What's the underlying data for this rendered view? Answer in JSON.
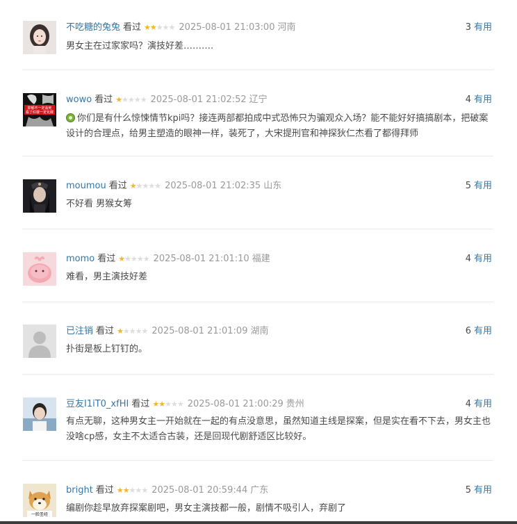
{
  "comments": [
    {
      "user": "不吃糖的兔兔",
      "status": "看过",
      "rating": 2,
      "time": "2025-08-01 21:03:00",
      "location": "河南",
      "votes": "3",
      "vote_label": "有用",
      "text": "男女主在过家家吗？演技好差……….",
      "avatar": "woman-portrait",
      "has_icon": false
    },
    {
      "user": "wowo",
      "status": "看过",
      "rating": 1,
      "time": "2025-08-01 21:02:52",
      "location": "辽宁",
      "votes": "4",
      "vote_label": "有用",
      "text": "你们是有什么惊悚情节kpi吗？接连两部都拍成中式恐怖只为骗观众入场？能不能好好搞搞剧本，把破案设计的合理点，给男主塑造的眼神一样，装死了，大宋提刑官和神探狄仁杰看了都得拜师",
      "avatar": "red-banner",
      "has_icon": true,
      "avatar_text": [
        "抑郁不一定会死",
        "看了红楼一定化蝶"
      ]
    },
    {
      "user": "moumou",
      "status": "看过",
      "rating": 1,
      "time": "2025-08-01 21:02:35",
      "location": "山东",
      "votes": "5",
      "vote_label": "有用",
      "text": "不好看 男猴女筹",
      "avatar": "costume-portrait",
      "has_icon": false
    },
    {
      "user": "momo",
      "status": "看过",
      "rating": 1,
      "time": "2025-08-01 21:01:10",
      "location": "福建",
      "votes": "4",
      "vote_label": "有用",
      "text": "难看，男主演技好差",
      "avatar": "pink-creature",
      "has_icon": false
    },
    {
      "user": "已注销",
      "status": "看过",
      "rating": 1,
      "time": "2025-08-01 21:01:09",
      "location": "湖南",
      "votes": "6",
      "vote_label": "有用",
      "text": "扑街是板上钉钉的。",
      "avatar": "default-user",
      "has_icon": false
    },
    {
      "user": "豆友I1iT0_xfHI",
      "status": "看过",
      "rating": 2,
      "time": "2025-08-01 21:00:29",
      "location": "贵州",
      "votes": "4",
      "vote_label": "有用",
      "text": "有点无聊，这种男女主一开始就在一起的有点没意思，虽然知道主线是探案，但是实在看不下去，男女主也没啥cp感，女主不太适合古装，还是回现代剧舒适区比较好。",
      "avatar": "boy-portrait",
      "has_icon": false
    },
    {
      "user": "bright",
      "status": "看过",
      "rating": 2,
      "time": "2025-08-01 20:59:44",
      "location": "广东",
      "votes": "5",
      "vote_label": "有用",
      "text": "编剧你趁早放弃探案剧吧，男女主演技都一般，剧情不吸引人，弃剧了",
      "avatar": "shiba-dog",
      "has_icon": false,
      "avatar_text": [
        "一脸圣经"
      ]
    }
  ],
  "colors": {
    "link": "#3377aa",
    "star_on": "#f7b32e",
    "star_off": "#dddddd",
    "text": "#494949",
    "muted": "#999999"
  }
}
